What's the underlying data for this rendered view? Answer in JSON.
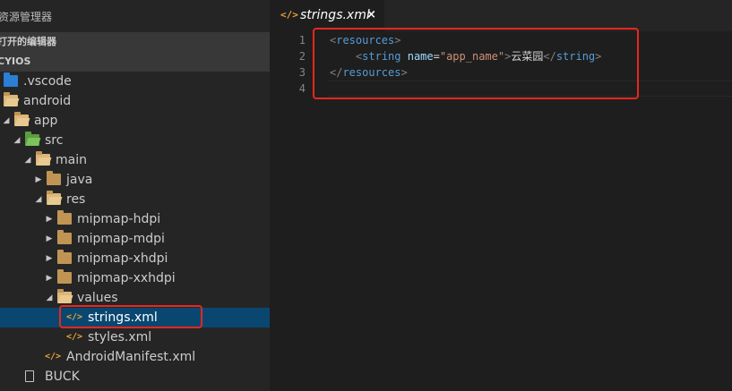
{
  "sidebar": {
    "title": "资源管理器",
    "open_editors_label": "打开的编辑器",
    "project_label": "CYIOS",
    "tree": [
      {
        "label": ".vscode",
        "kind": "folder-vscode",
        "expanded": false
      },
      {
        "label": "android",
        "kind": "folder",
        "expanded": true
      },
      {
        "label": "app",
        "kind": "folder",
        "expanded": true
      },
      {
        "label": "src",
        "kind": "folder-src",
        "expanded": true
      },
      {
        "label": "main",
        "kind": "folder",
        "expanded": true
      },
      {
        "label": "java",
        "kind": "folder",
        "expanded": false
      },
      {
        "label": "res",
        "kind": "folder",
        "expanded": true
      },
      {
        "label": "mipmap-hdpi",
        "kind": "folder",
        "expanded": false
      },
      {
        "label": "mipmap-mdpi",
        "kind": "folder",
        "expanded": false
      },
      {
        "label": "mipmap-xhdpi",
        "kind": "folder",
        "expanded": false
      },
      {
        "label": "mipmap-xxhdpi",
        "kind": "folder",
        "expanded": false
      },
      {
        "label": "values",
        "kind": "folder",
        "expanded": true
      },
      {
        "label": "strings.xml",
        "kind": "xml",
        "selected": true
      },
      {
        "label": "styles.xml",
        "kind": "xml"
      },
      {
        "label": "AndroidManifest.xml",
        "kind": "xml"
      },
      {
        "label": "BUCK",
        "kind": "file"
      }
    ]
  },
  "tab": {
    "icon": "xml-file-icon",
    "icon_glyph": "</>",
    "label": "strings.xml",
    "close_glyph": "×"
  },
  "editor": {
    "line_numbers": [
      "1",
      "2",
      "3",
      "4"
    ],
    "lines": [
      {
        "parts": [
          [
            "pn",
            "<"
          ],
          [
            "tg",
            "resources"
          ],
          [
            "pn",
            ">"
          ]
        ]
      },
      {
        "parts": [
          [
            "tx",
            "    "
          ],
          [
            "pn",
            "<"
          ],
          [
            "tg",
            "string "
          ],
          [
            "at",
            "name"
          ],
          [
            "tx",
            "="
          ],
          [
            "av",
            "\"app_name\""
          ],
          [
            "pn",
            ">"
          ],
          [
            "tx",
            "云菜园"
          ],
          [
            "pn",
            "</"
          ],
          [
            "tg",
            "string"
          ],
          [
            "pn",
            ">"
          ]
        ]
      },
      {
        "parts": [
          [
            "pn",
            "</"
          ],
          [
            "tg",
            "resources"
          ],
          [
            "pn",
            ">"
          ]
        ]
      },
      {
        "parts": []
      }
    ]
  },
  "colors": {
    "highlight": "#e8271f",
    "selection": "#094771",
    "sidebar_bg": "#252526",
    "editor_bg": "#1e1e1e"
  }
}
